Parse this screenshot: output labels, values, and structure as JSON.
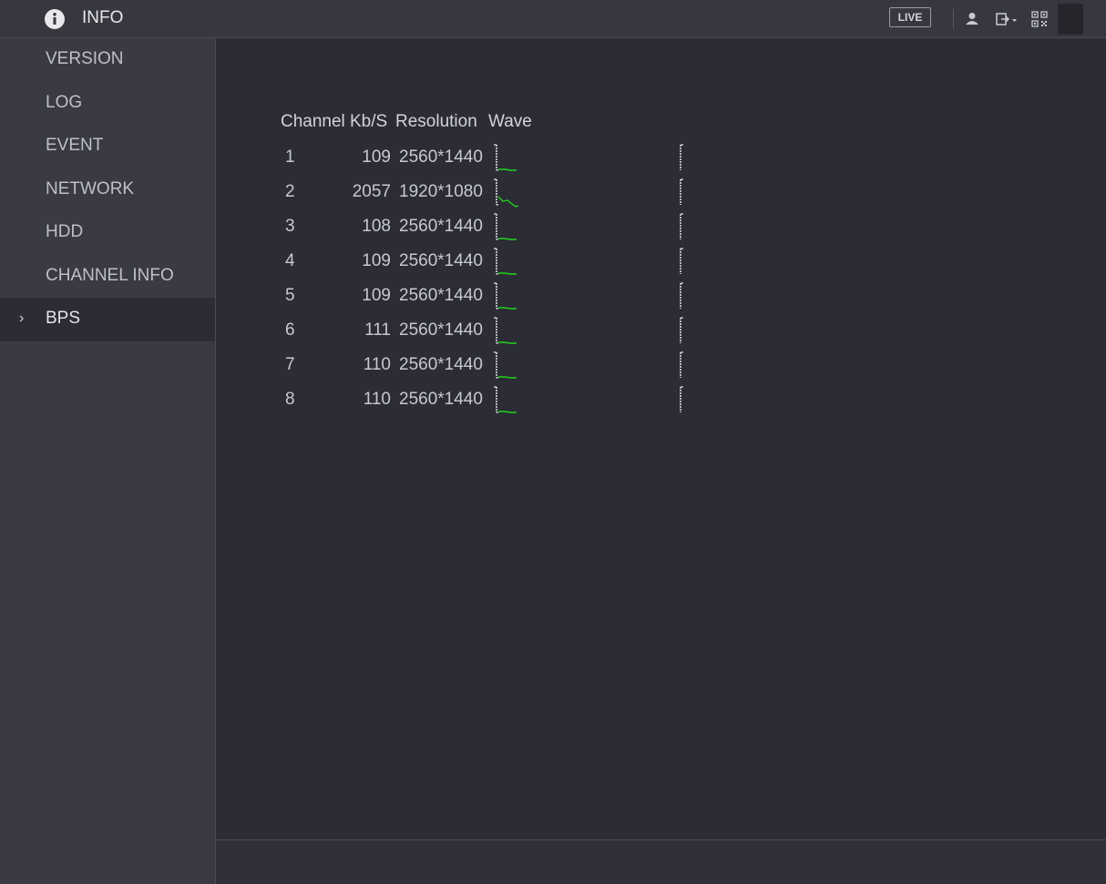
{
  "header": {
    "title": "INFO",
    "live_label": "LIVE",
    "icons": [
      "info-icon",
      "user-icon",
      "logout-icon",
      "qr-code-icon"
    ]
  },
  "sidebar": {
    "items": [
      {
        "label": "VERSION",
        "active": false
      },
      {
        "label": "LOG",
        "active": false
      },
      {
        "label": "EVENT",
        "active": false
      },
      {
        "label": "NETWORK",
        "active": false
      },
      {
        "label": "HDD",
        "active": false
      },
      {
        "label": "CHANNEL INFO",
        "active": false
      },
      {
        "label": "BPS",
        "active": true
      }
    ]
  },
  "bps_table": {
    "columns": {
      "channel": "Channel",
      "kbs": "Kb/S",
      "resolution": "Resolution",
      "wave": "Wave"
    },
    "rows": [
      {
        "channel": "1",
        "kbs": "109",
        "resolution": "2560*1440"
      },
      {
        "channel": "2",
        "kbs": "2057",
        "resolution": "1920*1080"
      },
      {
        "channel": "3",
        "kbs": "108",
        "resolution": "2560*1440"
      },
      {
        "channel": "4",
        "kbs": "109",
        "resolution": "2560*1440"
      },
      {
        "channel": "5",
        "kbs": "109",
        "resolution": "2560*1440"
      },
      {
        "channel": "6",
        "kbs": "111",
        "resolution": "2560*1440"
      },
      {
        "channel": "7",
        "kbs": "110",
        "resolution": "2560*1440"
      },
      {
        "channel": "8",
        "kbs": "110",
        "resolution": "2560*1440"
      }
    ]
  },
  "colors": {
    "wave_line": "#22d41e",
    "accent_text": "#e6e7ea"
  }
}
